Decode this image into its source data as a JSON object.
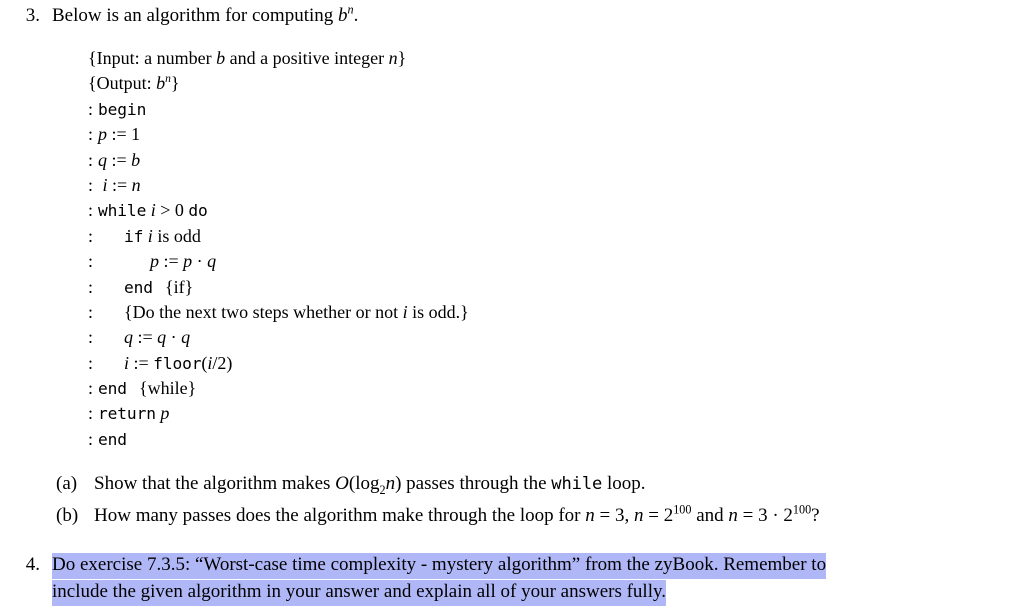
{
  "document": {
    "background_color": "#ffffff",
    "text_color": "#000000",
    "selection_highlight_color": "#b0b7f7"
  },
  "item3": {
    "number": "3.",
    "text_before_math": "Below is an algorithm for computing ",
    "math_base": "b",
    "math_exponent": "n",
    "text_after_math": "."
  },
  "algorithm": {
    "input_spec": {
      "open_brace": "{",
      "label": "Input:",
      "text_1": " a number ",
      "var_b": "b",
      "text_2": " and a positive integer ",
      "var_n": "n",
      "close_brace": "}"
    },
    "output_spec": {
      "open_brace": "{",
      "label": "Output:",
      "space": " ",
      "var_b": "b",
      "exponent_n": "n",
      "close_brace": "}"
    },
    "lines": [
      {
        "colon": ":",
        "keyword": "begin"
      },
      {
        "colon": ":",
        "assign_lhs": "p",
        "assign_op": ":=",
        "assign_rhs": "1"
      },
      {
        "colon": ":",
        "assign_lhs": "q",
        "assign_op": ":=",
        "assign_rhs": "b"
      },
      {
        "colon": ":",
        "assign_lhs": "i",
        "assign_op": ":=",
        "assign_rhs": "n"
      },
      {
        "colon": ":",
        "keyword": "while",
        "condition_var": "i",
        "condition_op": ">",
        "condition_val": "0",
        "keyword2": "do"
      },
      {
        "colon": ":",
        "keyword": "if",
        "text": " is odd",
        "var": "i"
      },
      {
        "colon": ":",
        "assign_lhs": "p",
        "assign_op": ":=",
        "rhs_a": "p",
        "rhs_op": "·",
        "rhs_b": "q"
      },
      {
        "colon": ":",
        "keyword": "end",
        "comment": "{if}"
      },
      {
        "colon": ":",
        "comment_full_a": "{Do the next two steps whether or not ",
        "comment_var": "i",
        "comment_full_b": " is odd.}"
      },
      {
        "colon": ":",
        "assign_lhs": "q",
        "assign_op": ":=",
        "rhs_a": "q",
        "rhs_op": "·",
        "rhs_b": "q"
      },
      {
        "colon": ":",
        "assign_lhs": "i",
        "assign_op": ":=",
        "func": "floor",
        "func_arg_open": "(",
        "func_var": "i",
        "func_arg_rest": "/2)"
      },
      {
        "colon": ":",
        "keyword": "end",
        "comment": "{while}"
      },
      {
        "colon": ":",
        "keyword": "return",
        "var": "p"
      },
      {
        "colon": ":",
        "keyword": "end"
      }
    ]
  },
  "sub_a": {
    "label": "(a)",
    "text_1": "Show that the algorithm makes ",
    "bigo": "O",
    "paren_open": "(",
    "log": "log",
    "log_base": "2",
    "log_arg": "n",
    "paren_close": ")",
    "text_2": " passes through the ",
    "keyword": "while",
    "text_3": " loop."
  },
  "sub_b": {
    "label": "(b)",
    "text_1": "How many passes does the algorithm make through the loop for ",
    "var_n1": "n",
    "eq1": " = ",
    "val1": "3,",
    "var_n2": "n",
    "eq2": " = ",
    "val2_base": "2",
    "val2_exp": "100",
    "text_2": " and ",
    "var_n3": "n",
    "eq3": " = ",
    "val3_coef": "3",
    "val3_dot": " · ",
    "val3_base": "2",
    "val3_exp": "100",
    "text_3": "?"
  },
  "item4": {
    "number": "4.",
    "text_1": "Do exercise 7.3.5: “Worst-case time complexity - mystery algorithm” from the zyBook. Remember to",
    "text_2": "include the given algorithm in your answer and explain all of your answers fully.",
    "is_highlighted": true
  }
}
